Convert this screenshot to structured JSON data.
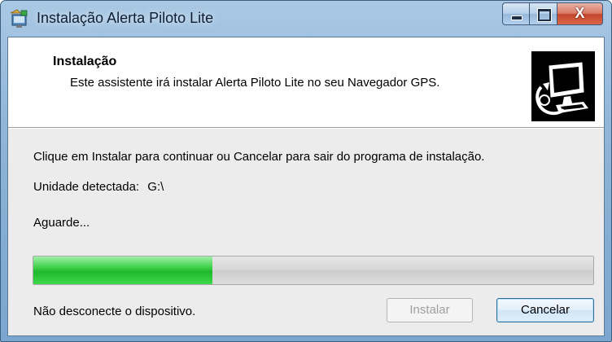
{
  "window": {
    "title": "Instalação Alerta Piloto Lite",
    "close_glyph": "X",
    "icon": "installer-icon"
  },
  "header": {
    "title": "Instalação",
    "subtitle": "Este assistente irá instalar Alerta Piloto Lite no seu Navegador GPS.",
    "graphic": "computer-install-icon"
  },
  "body": {
    "instructions": "Clique em Instalar para continuar ou Cancelar para sair do programa de instalação.",
    "drive_label": "Unidade detectada:",
    "drive_value": "G:\\",
    "status": "Aguarde...",
    "warning": "Não desconecte o dispositivo."
  },
  "progress": {
    "fraction": 0.32
  },
  "buttons": {
    "install_label": "Instalar",
    "cancel_label": "Cancelar"
  }
}
